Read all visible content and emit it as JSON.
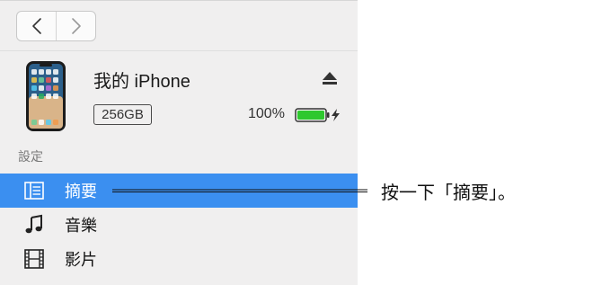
{
  "toolbar": {
    "back_icon": "chevron-left-icon",
    "forward_icon": "chevron-right-icon"
  },
  "device": {
    "name": "我的 iPhone",
    "capacity": "256GB",
    "battery_percent": "100%",
    "battery_level": 1.0,
    "charging": true,
    "icon": "iphone-icon",
    "eject_icon": "eject-icon"
  },
  "settings": {
    "section_label": "設定",
    "items": [
      {
        "label": "摘要",
        "icon": "summary-list-icon",
        "selected": true
      },
      {
        "label": "音樂",
        "icon": "music-note-icon",
        "selected": false
      },
      {
        "label": "影片",
        "icon": "film-icon",
        "selected": false
      }
    ]
  },
  "callout": {
    "text": "按一下「摘要」。"
  },
  "colors": {
    "selection": "#3b8ff0",
    "sidebar_bg": "#f0efef",
    "battery_fill": "#2ec82e"
  }
}
